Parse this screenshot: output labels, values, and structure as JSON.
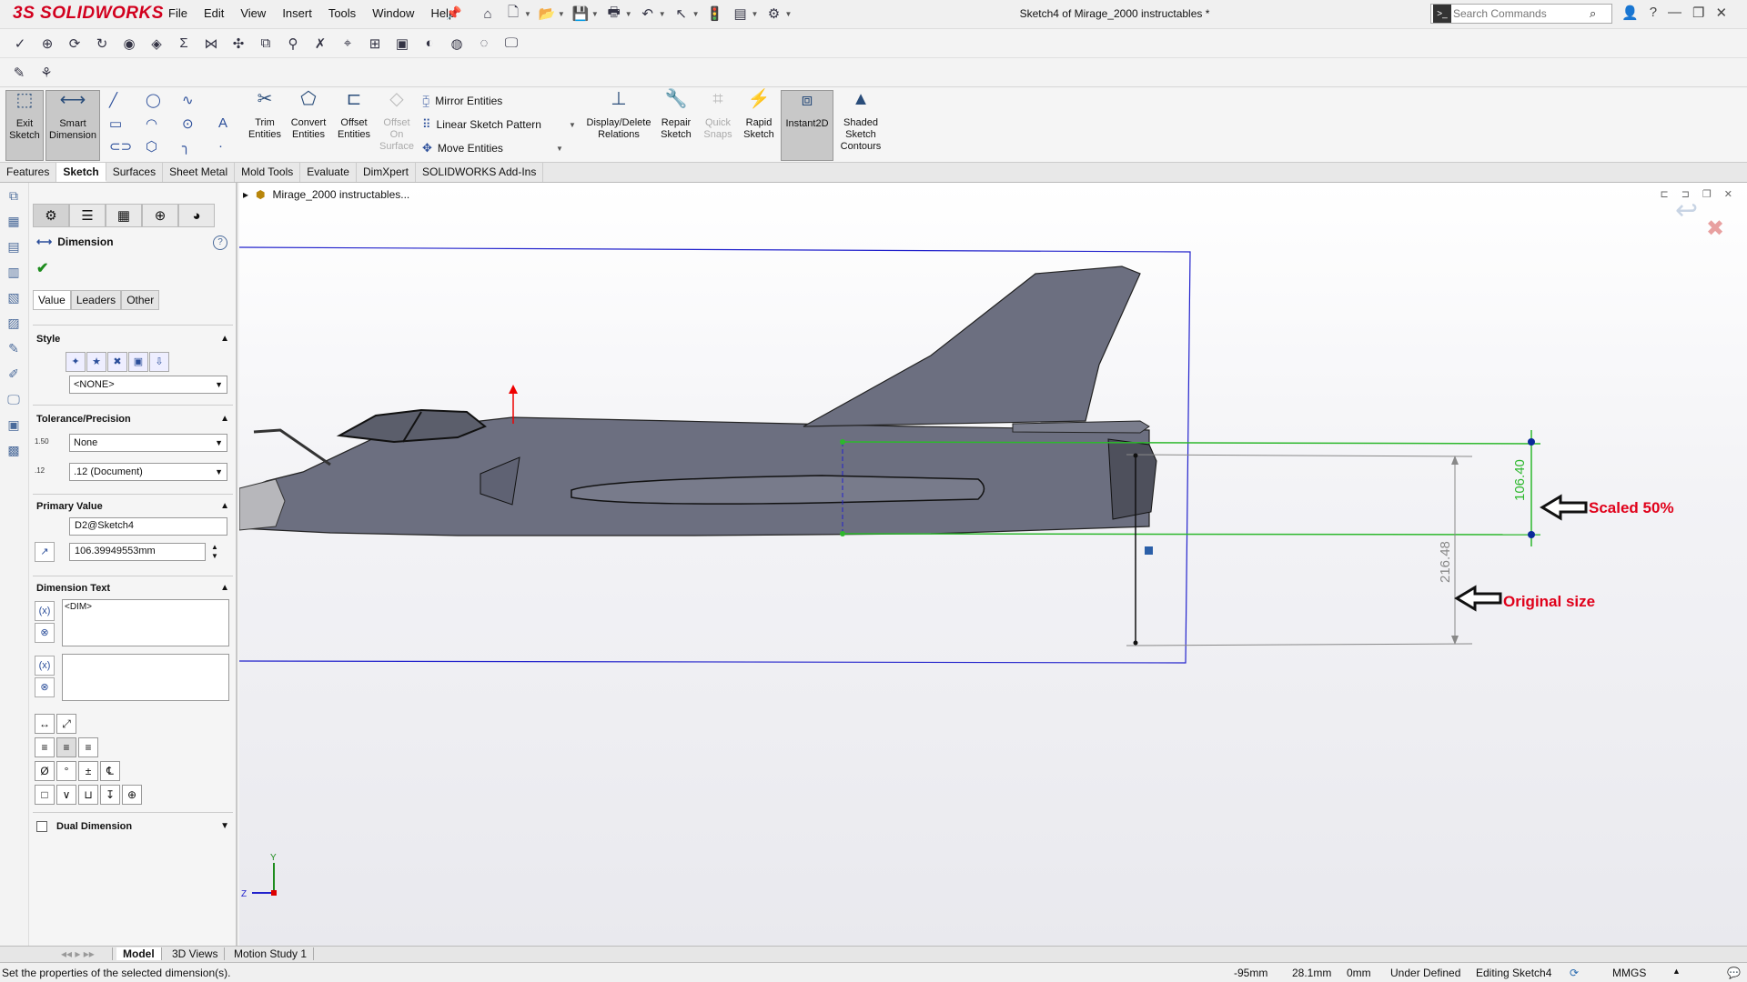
{
  "app": {
    "brand_prefix": "3S",
    "brand": "SOLIDWORKS",
    "doc_title": "Sketch4 of Mirage_2000 instructables *"
  },
  "menu": [
    "File",
    "Edit",
    "View",
    "Insert",
    "Tools",
    "Window",
    "Help"
  ],
  "search": {
    "placeholder": "Search Commands"
  },
  "ribbon": {
    "exit_sketch": "Exit Sketch",
    "smart_dimension": "Smart Dimension",
    "trim_entities": "Trim Entities",
    "convert_entities": "Convert Entities",
    "offset_entities": "Offset Entities",
    "offset_on_surface": "Offset On Surface",
    "mirror_entities": "Mirror Entities",
    "linear_sketch_pattern": "Linear Sketch Pattern",
    "move_entities": "Move Entities",
    "display_delete_relations": "Display/Delete Relations",
    "repair_sketch": "Repair Sketch",
    "quick_snaps": "Quick Snaps",
    "rapid_sketch": "Rapid Sketch",
    "instant2d": "Instant2D",
    "shaded_sketch_contours": "Shaded Sketch Contours"
  },
  "tabs": [
    "Features",
    "Sketch",
    "Surfaces",
    "Sheet Metal",
    "Mold Tools",
    "Evaluate",
    "DimXpert",
    "SOLIDWORKS Add-Ins"
  ],
  "active_tab": "Sketch",
  "panel": {
    "title": "Dimension",
    "help": "?",
    "subtabs": [
      "Value",
      "Leaders",
      "Other"
    ],
    "style_label": "Style",
    "style_value": "<NONE>",
    "tolerance_label": "Tolerance/Precision",
    "tolerance_value": "None",
    "precision_value": ".12 (Document)",
    "tol_icon_text": "1.50",
    "prec_icon_text": ".12",
    "primary_label": "Primary Value",
    "primary_name": "D2@Sketch4",
    "primary_value": "106.39949553mm",
    "dimtext_label": "Dimension Text",
    "dimtext_value": "<DIM>",
    "dual_label": "Dual Dimension"
  },
  "tree": {
    "root": "Mirage_2000 instructables..."
  },
  "annotations": {
    "dim_scaled": "106.40",
    "dim_original": "216.48",
    "label_scaled": "Scaled 50%",
    "label_original": "Original size"
  },
  "triad": {
    "y": "Y",
    "z": "Z"
  },
  "bottom_tabs": [
    "Model",
    "3D Views",
    "Motion Study 1"
  ],
  "status": {
    "message": "Set the properties of the selected dimension(s).",
    "x": "-95mm",
    "y": "28.1mm",
    "z": "0mm",
    "state": "Under Defined",
    "editing": "Editing Sketch4",
    "units": "MMGS"
  },
  "colors": {
    "accent_red": "#d2001e",
    "sketch_green": "#2db82d",
    "box_blue": "#2222cc",
    "annotation_red": "#e0001a"
  }
}
